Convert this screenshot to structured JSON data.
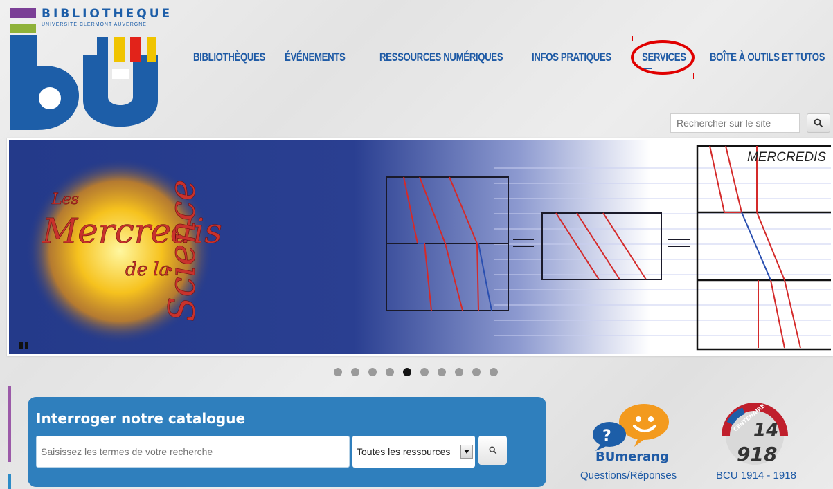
{
  "logo": {
    "title": "BIBLIOTHEQUE",
    "subtitle": "UNIVERSITÉ CLERMONT AUVERGNE",
    "mark_text": "bu"
  },
  "nav": {
    "items": [
      {
        "label": "BIBLIOTHÈQUES"
      },
      {
        "label": "ÉVÉNEMENTS"
      },
      {
        "label": "RESSOURCES NUMÉRIQUES"
      },
      {
        "label": "INFOS PRATIQUES"
      },
      {
        "label": "SERVICES"
      },
      {
        "label": "BOÎTE À OUTILS ET TUTOS"
      }
    ],
    "highlighted": "SERVICES",
    "highlight_color": "#e00000",
    "nav_color": "#1e5aa5"
  },
  "site_search": {
    "placeholder": "Rechercher sur le site",
    "icon": "search-icon"
  },
  "banner": {
    "title_line1": "Les",
    "title_line2": "Mercredis",
    "title_line3": "de la",
    "title_line4": "Science",
    "corner_label": "MERCREDIS",
    "pause_icon": "pause-icon"
  },
  "carousel": {
    "dot_count": 10,
    "active_index": 4
  },
  "catalogue": {
    "title": "Interroger notre catalogue",
    "placeholder": "Saisissez les termes de votre recherche",
    "select_value": "Toutes les ressources",
    "search_icon": "search-icon"
  },
  "links": {
    "bumerang": {
      "name": "BUmerang",
      "caption": "Questions/Réponses"
    },
    "bcu": {
      "caption": "BCU 1914 - 1918",
      "badge_text": "CENTENAIRE",
      "years": "1914 1918"
    }
  }
}
